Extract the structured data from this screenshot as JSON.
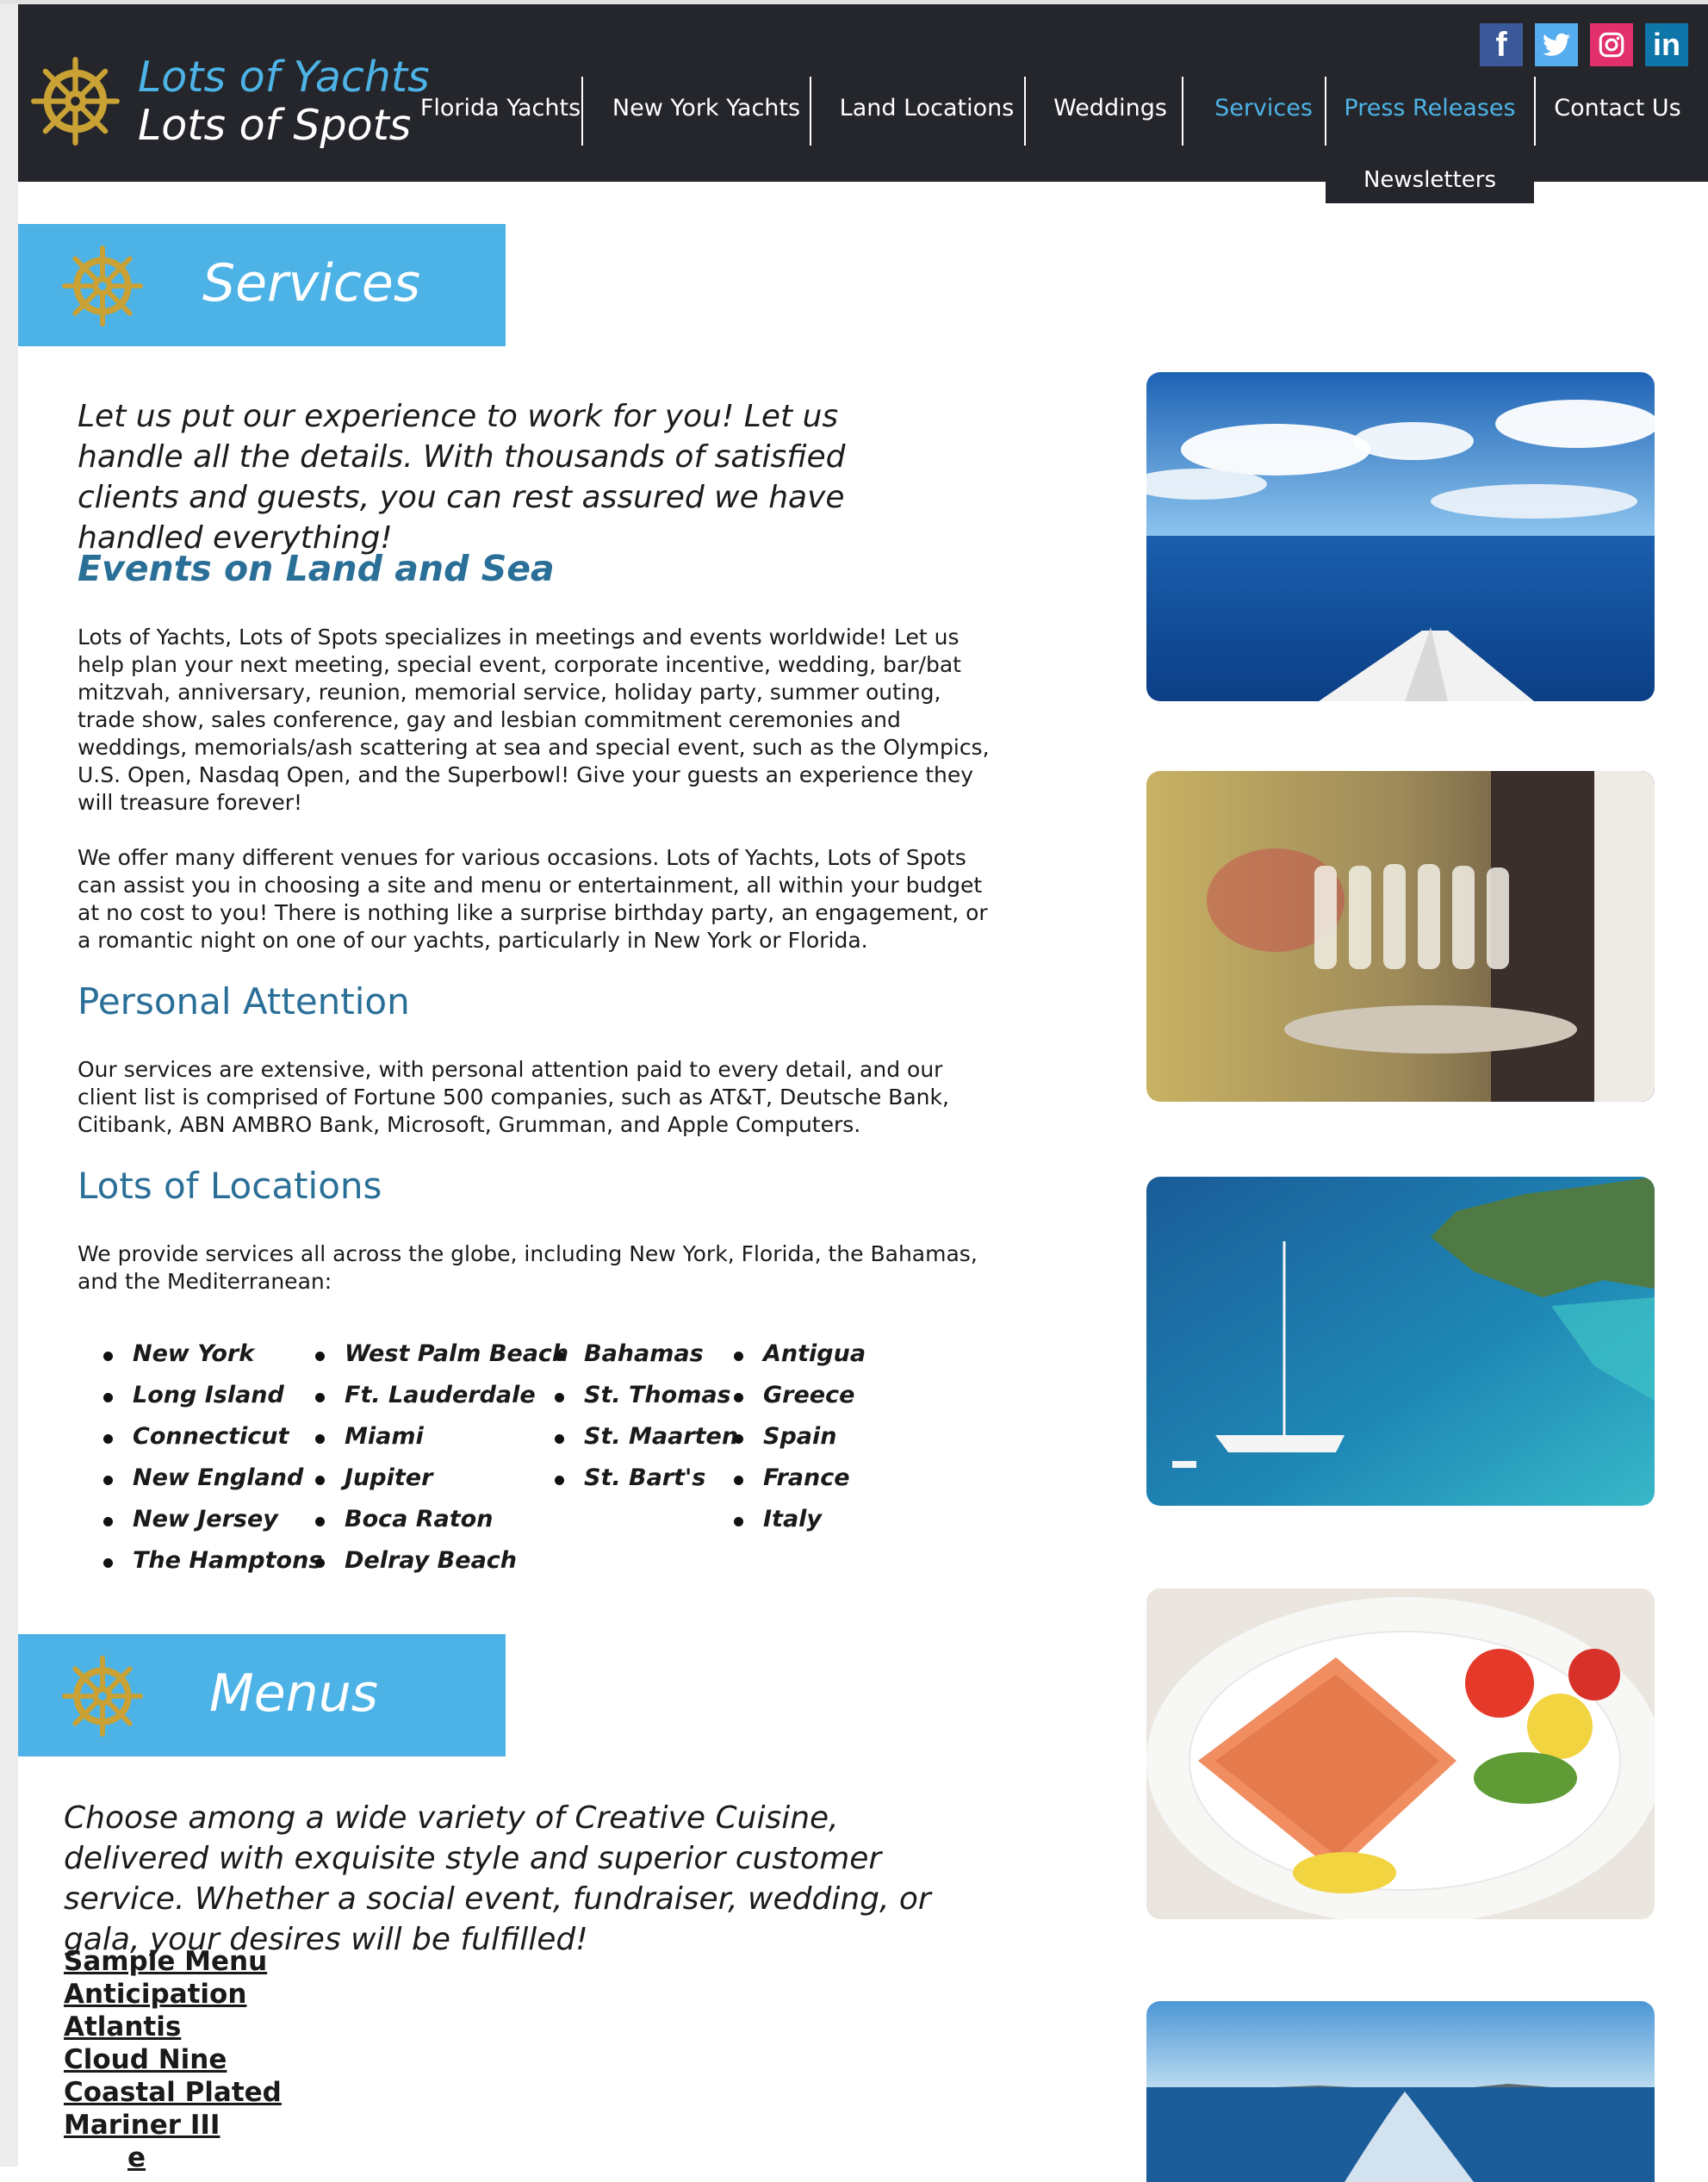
{
  "brand": {
    "line1": "Lots of Yachts",
    "line2": "Lots of Spots"
  },
  "nav": [
    {
      "label": "Florida Yachts"
    },
    {
      "label": "New York Yachts"
    },
    {
      "label": "Land Locations"
    },
    {
      "label": "Weddings"
    },
    {
      "label": "Services"
    },
    {
      "label": "Press Releases"
    },
    {
      "label": "Contact Us"
    }
  ],
  "nav_dropdown": {
    "label": "Newsletters"
  },
  "social": {
    "facebook": "f",
    "instagram": "",
    "linkedin": "in"
  },
  "services": {
    "title": "Services",
    "intro": "Let us put our experience to work for you! Let us handle all the details. With thousands of satisfied clients and guests, you can rest assured we have handled everything!",
    "events_heading": "Events on Land and Sea",
    "events_p1": "Lots of Yachts, Lots of Spots specializes in meetings and events worldwide! Let us help plan your next meeting, special event, corporate incentive, wedding, bar/bat mitzvah, anniversary, reunion, memorial service, holiday party, summer outing, trade show, sales conference, gay and lesbian commitment ceremonies and weddings, memorials/ash scattering at sea and special event, such as the Olympics, U.S. Open, Nasdaq Open, and the Superbowl! Give your guests an experience they will treasure forever!",
    "events_p2": "We offer many different venues for various occasions. Lots of Yachts, Lots of Spots can assist you in choosing a site and menu or entertainment, all within your budget at no cost to you! There is nothing like a surprise birthday party, an engagement, or a romantic night on one of our yachts, particularly in New York or Florida.",
    "attention_heading": "Personal Attention",
    "attention_p": "Our services are extensive, with personal attention paid to every detail, and our client list is comprised of Fortune 500 companies, such as AT&T, Deutsche Bank, Citibank, ABN AMBRO Bank, Microsoft, Grumman, and Apple Computers.",
    "locations_heading": "Lots of Locations",
    "locations_p": "We provide services all across the globe, including New York, Florida, the Bahamas, and the Mediterranean:",
    "locations": [
      [
        "New York",
        "Long Island",
        "Connecticut",
        "New England",
        "New Jersey",
        "The Hamptons"
      ],
      [
        "West Palm Beach",
        "Ft. Lauderdale",
        "Miami",
        "Jupiter",
        "Boca Raton",
        "Delray Beach"
      ],
      [
        "Bahamas",
        "St. Thomas",
        "St. Maarten",
        "St. Bart's"
      ],
      [
        "Antigua",
        "Greece",
        "Spain",
        "France",
        "Italy"
      ]
    ]
  },
  "menus": {
    "title": "Menus",
    "intro": "Choose among a wide variety of Creative Cuisine, delivered with exquisite style and superior customer service. Whether a social event, fundraiser, wedding, or gala, your desires will be fulfilled!",
    "links": [
      "Sample Menu",
      "Anticipation",
      "Atlantis",
      "Cloud Nine",
      "Coastal Plated",
      "Mariner III",
      "e"
    ]
  },
  "colors": {
    "header_bg": "#24262b",
    "accent": "#4db3e6",
    "heading": "#2a6f97",
    "wheel": "#c9a134"
  }
}
